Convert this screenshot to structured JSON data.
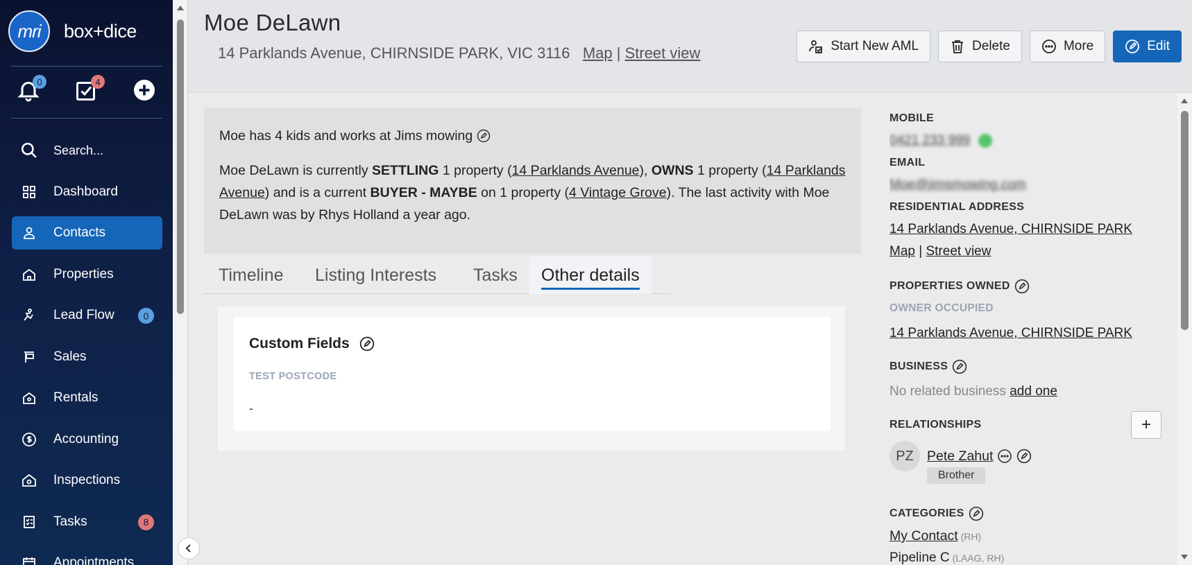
{
  "brand": {
    "logo_text": "mri",
    "name": "box+dice"
  },
  "quick": {
    "notifications_count": "0",
    "tasks_count": "4"
  },
  "nav": {
    "search": "Search...",
    "items": [
      {
        "label": "Dashboard",
        "icon": "dashboard-icon",
        "badge": ""
      },
      {
        "label": "Contacts",
        "icon": "person-icon",
        "badge": ""
      },
      {
        "label": "Properties",
        "icon": "house-icon",
        "badge": ""
      },
      {
        "label": "Lead Flow",
        "icon": "lead-flow-icon",
        "badge": "0"
      },
      {
        "label": "Sales",
        "icon": "sign-icon",
        "badge": ""
      },
      {
        "label": "Rentals",
        "icon": "rental-house-icon",
        "badge": ""
      },
      {
        "label": "Accounting",
        "icon": "dollar-circle-icon",
        "badge": ""
      },
      {
        "label": "Inspections",
        "icon": "inspection-house-icon",
        "badge": ""
      },
      {
        "label": "Tasks",
        "icon": "task-list-icon",
        "badge": "8"
      },
      {
        "label": "Appointments",
        "icon": "calendar-icon",
        "badge": ""
      }
    ]
  },
  "header": {
    "name": "Moe DeLawn",
    "address": "14 Parklands Avenue, CHIRNSIDE PARK, VIC 3116",
    "map_link": "Map",
    "street_view_link": "Street view",
    "buttons": {
      "aml": "Start New AML",
      "delete": "Delete",
      "more": "More",
      "edit": "Edit"
    }
  },
  "summary": {
    "note": "Moe has 4 kids and works at Jims mowing",
    "p1": "Moe DeLawn is currently ",
    "settling": "SETTLING",
    "p2": " 1 property (",
    "link1": "14 Parklands Avenue",
    "p3": "), ",
    "owns": "OWNS",
    "p4": " 1 property (",
    "link2": "14 Parklands Avenue",
    "p5": ") and is a current ",
    "buyer": "BUYER - MAYBE",
    "p6": " on 1 property (",
    "link3": "4 Vintage Grove",
    "p7": "). The last activity with Moe DeLawn was by Rhys Holland a year ago."
  },
  "tabs": [
    "Timeline",
    "Listing Interests",
    "Tasks",
    "Other details"
  ],
  "custom_fields": {
    "title": "Custom Fields",
    "field_label": "TEST POSTCODE",
    "field_value": "-"
  },
  "sidebar_right": {
    "mobile_label": "MOBILE",
    "mobile_value": "0421 233 999",
    "email_label": "EMAIL",
    "email_value": "Moe@jimsmowing.com",
    "res_label": "RESIDENTIAL ADDRESS",
    "res_address": "14 Parklands Avenue, CHIRNSIDE PARK",
    "res_map": "Map",
    "res_street": "Street view",
    "props_owned_label": "PROPERTIES OWNED",
    "owner_occupied_label": "OWNER OCCUPIED",
    "owned_address": "14 Parklands Avenue, CHIRNSIDE PARK",
    "business_label": "BUSINESS",
    "business_none": "No related business",
    "business_add": "add one",
    "relationships_label": "RELATIONSHIPS",
    "rel_initials": "PZ",
    "rel_name": "Pete Zahut",
    "rel_type": "Brother",
    "categories_label": "CATEGORIES",
    "cat1": "My Contact",
    "cat1_meta": "(RH)",
    "cat2": "Pipeline C",
    "cat2_meta": "(LAAG, RH)"
  },
  "colors": {
    "primary": "#1566b8",
    "sidebar_bg": "#0b1230",
    "badge_blue": "#5aa0e0",
    "badge_red": "#e07878"
  }
}
